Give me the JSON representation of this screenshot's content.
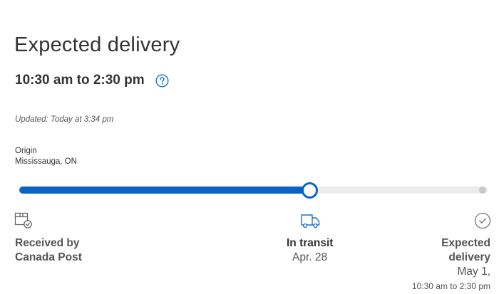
{
  "delivery": {
    "heading": "Expected delivery",
    "window": "10:30 am to 2:30 pm",
    "help_icon": "question-circle-icon",
    "updated": "Updated: Today at 3:34 pm"
  },
  "origin": {
    "label": "Origin",
    "location": "Mississauga, ON"
  },
  "progress": {
    "fraction": 0.62,
    "fill_color": "#0b63c5",
    "track_color": "#ececec"
  },
  "stages": [
    {
      "icon": "package-check-icon",
      "title_line1": "Received by",
      "title_line2": "Canada Post"
    },
    {
      "icon": "delivery-truck-icon",
      "title": "In transit",
      "date": "Apr. 28"
    },
    {
      "icon": "check-circle-icon",
      "title_line1": "Expected",
      "title_line2": "delivery",
      "date": "May 1,",
      "time": "10:30 am to 2:30 pm"
    }
  ]
}
